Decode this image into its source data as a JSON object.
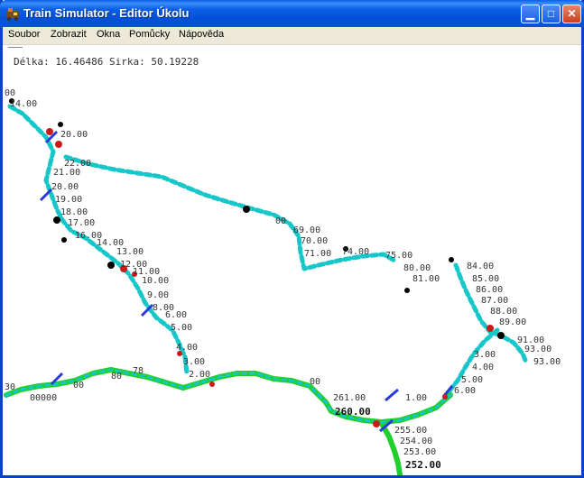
{
  "window": {
    "title": "Train Simulator - Editor Úkolu"
  },
  "menu": [
    "Soubor",
    "Zobrazit",
    "Okna",
    "Pomůcky",
    "Nápověda"
  ],
  "status": {
    "coordinates": "Délka: 16.46486 Sirka: 50.19228"
  },
  "map": {
    "labels": [
      "00",
      "14.00",
      "20.00",
      "22.00",
      "21.00",
      "20.00",
      "19.00",
      "18.00",
      "17.00",
      "16.00",
      "14.00",
      "13.00",
      "12.00",
      "11.00",
      "10.00",
      "9.00",
      "8.00",
      "6.00",
      "5.00",
      "4.00",
      "3.00",
      "2.00",
      "00",
      "69.00",
      "70.00",
      "71.00",
      "74.00",
      "75.00",
      "80.00",
      "81.00",
      "84.00",
      "85.00",
      "86.00",
      "87.00",
      "88.00",
      "89.00",
      "91.00",
      "93.00",
      "93.00",
      "3.00",
      "4.00",
      "5.00",
      "6.00",
      "1.00",
      "261.00",
      "260.00",
      "255.00",
      "254.00",
      "253.00",
      "252.00",
      "30",
      "00000",
      "00",
      "80",
      "78",
      "00"
    ]
  }
}
